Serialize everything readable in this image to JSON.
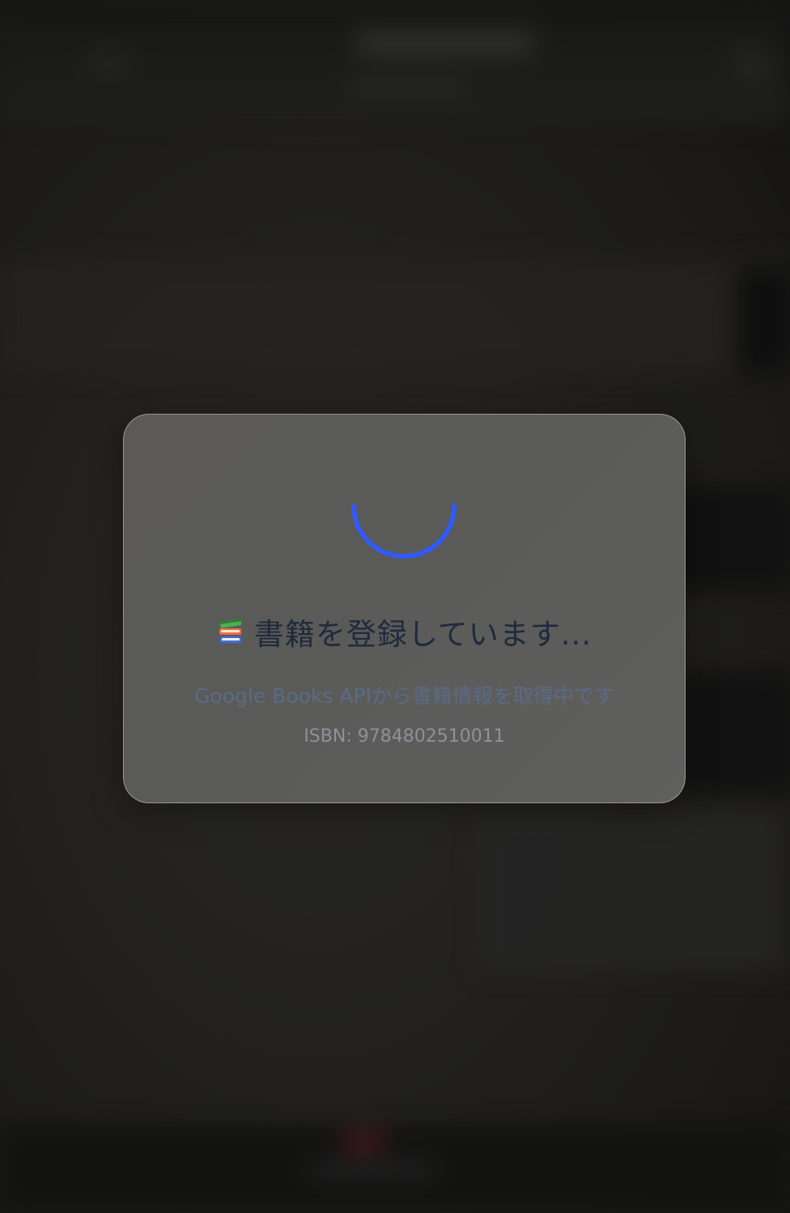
{
  "loading_dialog": {
    "emoji_icon": "books-icon",
    "title": "書籍を登録しています...",
    "message": "Google Books APIから書籍情報を取得中です",
    "isbn_text": "ISBN: 9784802510011",
    "spinner_color": "#2f5bff"
  },
  "colors": {
    "title": "#1f2a3d",
    "message": "#5a6b86",
    "isbn": "#8d9299"
  }
}
